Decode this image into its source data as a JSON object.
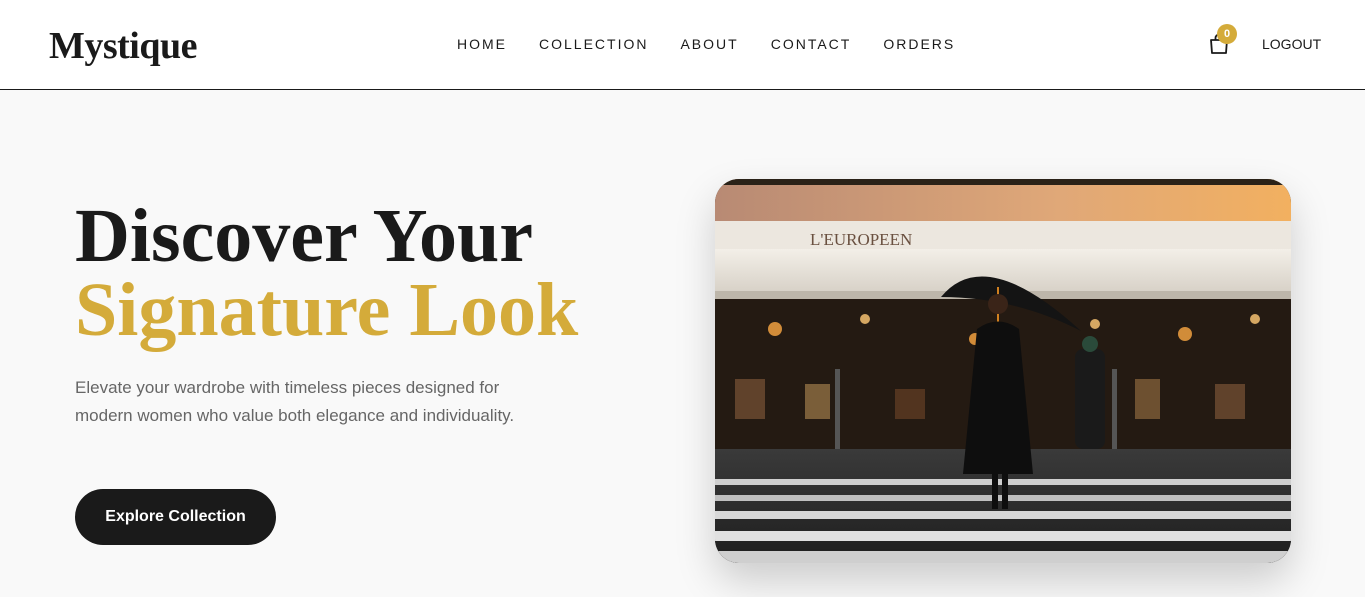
{
  "brand": {
    "logo": "Mystique"
  },
  "nav": {
    "links": [
      "HOME",
      "COLLECTION",
      "ABOUT",
      "CONTACT",
      "ORDERS"
    ],
    "cart_count": "0",
    "cart_icon": "shopping-bag-icon",
    "logout": "LOGOUT"
  },
  "hero": {
    "title_line1": "Discover Your",
    "title_line2": "Signature Look",
    "description": "Elevate your wardrobe with timeless pieces designed for modern women who value both elegance and individuality.",
    "cta": "Explore Collection",
    "image_storefront_sign": "L'EUROPEEN"
  },
  "colors": {
    "accent": "#d4ab3a",
    "dark": "#1a1a1a",
    "background": "#f9f9f9",
    "text_muted": "#666666"
  }
}
